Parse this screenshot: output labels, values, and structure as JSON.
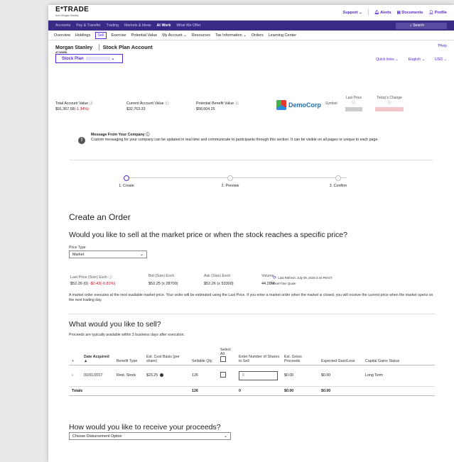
{
  "brand": {
    "logo": "E*TRADE",
    "logo_sub": "from Morgan Stanley"
  },
  "top_links": {
    "support": "Support",
    "alerts": "Alerts",
    "documents": "Documents",
    "profile": "Profile"
  },
  "main_nav": [
    "Accounts",
    "Pay & Transfer",
    "Trading",
    "Markets & Ideas",
    "At Work",
    "What We Offer"
  ],
  "main_nav_active": "At Work",
  "search": {
    "placeholder": "Search"
  },
  "sub_nav": [
    "Overview",
    "Holdings",
    "Sell",
    "Exercise",
    "Potential Value",
    "My Account",
    "Resources",
    "Tax Information",
    "Orders",
    "Learning Center"
  ],
  "sub_nav_active": "Sell",
  "account": {
    "ms_name": "Morgan Stanley",
    "ms_sub": "AT WORK",
    "title": "Stock Plan Account",
    "help": "Help",
    "plan_dropdown": "Stock Plan",
    "quick_links": "Quick links",
    "language": "English",
    "currency": "USD"
  },
  "summary": {
    "total_label": "Total Account Value",
    "total_value": "$91,367.58",
    "total_change": "(-1.34%)",
    "current_label": "Current Account Value",
    "current_value": "$32,763.33",
    "potential_label": "Potential Benefit Value",
    "potential_value": "$58,604.25",
    "company": "DemoCorp",
    "symbol_label": "Symbol",
    "last_price_label": "Last Price",
    "todays_change_label": "Today's Change"
  },
  "message": {
    "title": "Message From Your Company",
    "body": "Custom messaging for your company can be updated in real time and communicate to participants through this section. It can be visible on all pages or unique to each page."
  },
  "steps": [
    "1. Create",
    "2. Preview",
    "3. Confirm"
  ],
  "order": {
    "heading": "Create an Order",
    "question": "Would you like to sell at the market price or when the stock reaches a specific price?",
    "price_type_label": "Price Type",
    "price_type_value": "Market",
    "quote_headers": [
      "Last Price (Size) Exch",
      "Bid (Size) Exch",
      "Ask (Size) Exch",
      "Volume"
    ],
    "last_price": "$52.26 (0)",
    "last_change": "-$0.43(-0.81%)",
    "bid": "$52.25 (x 28700)",
    "ask": "$52.26 (x 53300)",
    "volume": "44.28M",
    "last_refresh": "Last Refresh: July 08, 2025 3:44 PM ET",
    "real_time": "Real-Time Quote",
    "note": "A market order executes at the next available market price. Your order will be estimated using the Last Price. If you enter a market order when the market is closed, you will receive the current price when the market opens on the next trading day."
  },
  "sell": {
    "heading": "What would you like to sell?",
    "sub": "Proceeds are typically available within 3 business days after execution.",
    "columns": [
      "Date Acquired",
      "Benefit Type",
      "Est. Cost Basis (per share)",
      "Sellable Qty.",
      "Select All",
      "Enter Number of Shares to Sell",
      "Est. Gross Proceeds",
      "Expected Gain/Loss",
      "Capital Gains Status"
    ],
    "row": {
      "date": "01/01/2017",
      "type": "Rest. Stock",
      "basis": "$23.25",
      "qty": "126",
      "shares": "0",
      "gross": "$0.00",
      "gain": "$0.00",
      "status": "Long Term"
    },
    "totals": {
      "label": "Totals",
      "qty": "126",
      "shares": "0",
      "gross": "$0.00",
      "gain": "$0.00"
    }
  },
  "proceeds": {
    "heading": "How would you like to receive your proceeds?",
    "option": "Choose Disbursement Option"
  }
}
